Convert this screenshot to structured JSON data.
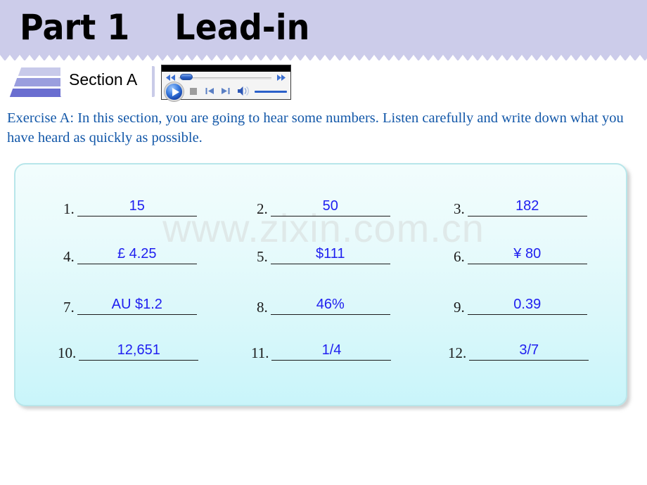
{
  "header": {
    "title": "Part 1    Lead-in",
    "background_color": "#ccccea"
  },
  "section_tab": {
    "label": "Section A",
    "bar_colors": [
      "#c8caea",
      "#9a9ede",
      "#6a6ed0"
    ]
  },
  "media_player": {
    "rewind_icon": "rewind-icon",
    "fast_forward_icon": "fast-forward-icon",
    "play_icon": "play-icon",
    "stop_icon": "stop-icon",
    "previous_icon": "previous-track-icon",
    "next_icon": "next-track-icon",
    "volume_icon": "volume-icon"
  },
  "instruction": {
    "text": "Exercise A: In this section, you are going to hear some numbers. Listen carefully and write down what you have heard as quickly as possible.",
    "color": "#1257a8"
  },
  "exercise_panel": {
    "watermark": "www.zixin.com.cn",
    "answer_color": "#2020f0",
    "items": [
      {
        "number": "1.",
        "answer": "15"
      },
      {
        "number": "2.",
        "answer": "50"
      },
      {
        "number": "3.",
        "answer": "182"
      },
      {
        "number": "4.",
        "answer": "£ 4.25"
      },
      {
        "number": "5.",
        "answer": "$111"
      },
      {
        "number": "6.",
        "answer": "¥ 80"
      },
      {
        "number": "7.",
        "answer": "AU $1.2"
      },
      {
        "number": "8.",
        "answer": "46%"
      },
      {
        "number": "9.",
        "answer": "0.39"
      },
      {
        "number": "10.",
        "answer": "12,651"
      },
      {
        "number": "11.",
        "answer": "1/4"
      },
      {
        "number": "12.",
        "answer": "3/7"
      }
    ]
  }
}
